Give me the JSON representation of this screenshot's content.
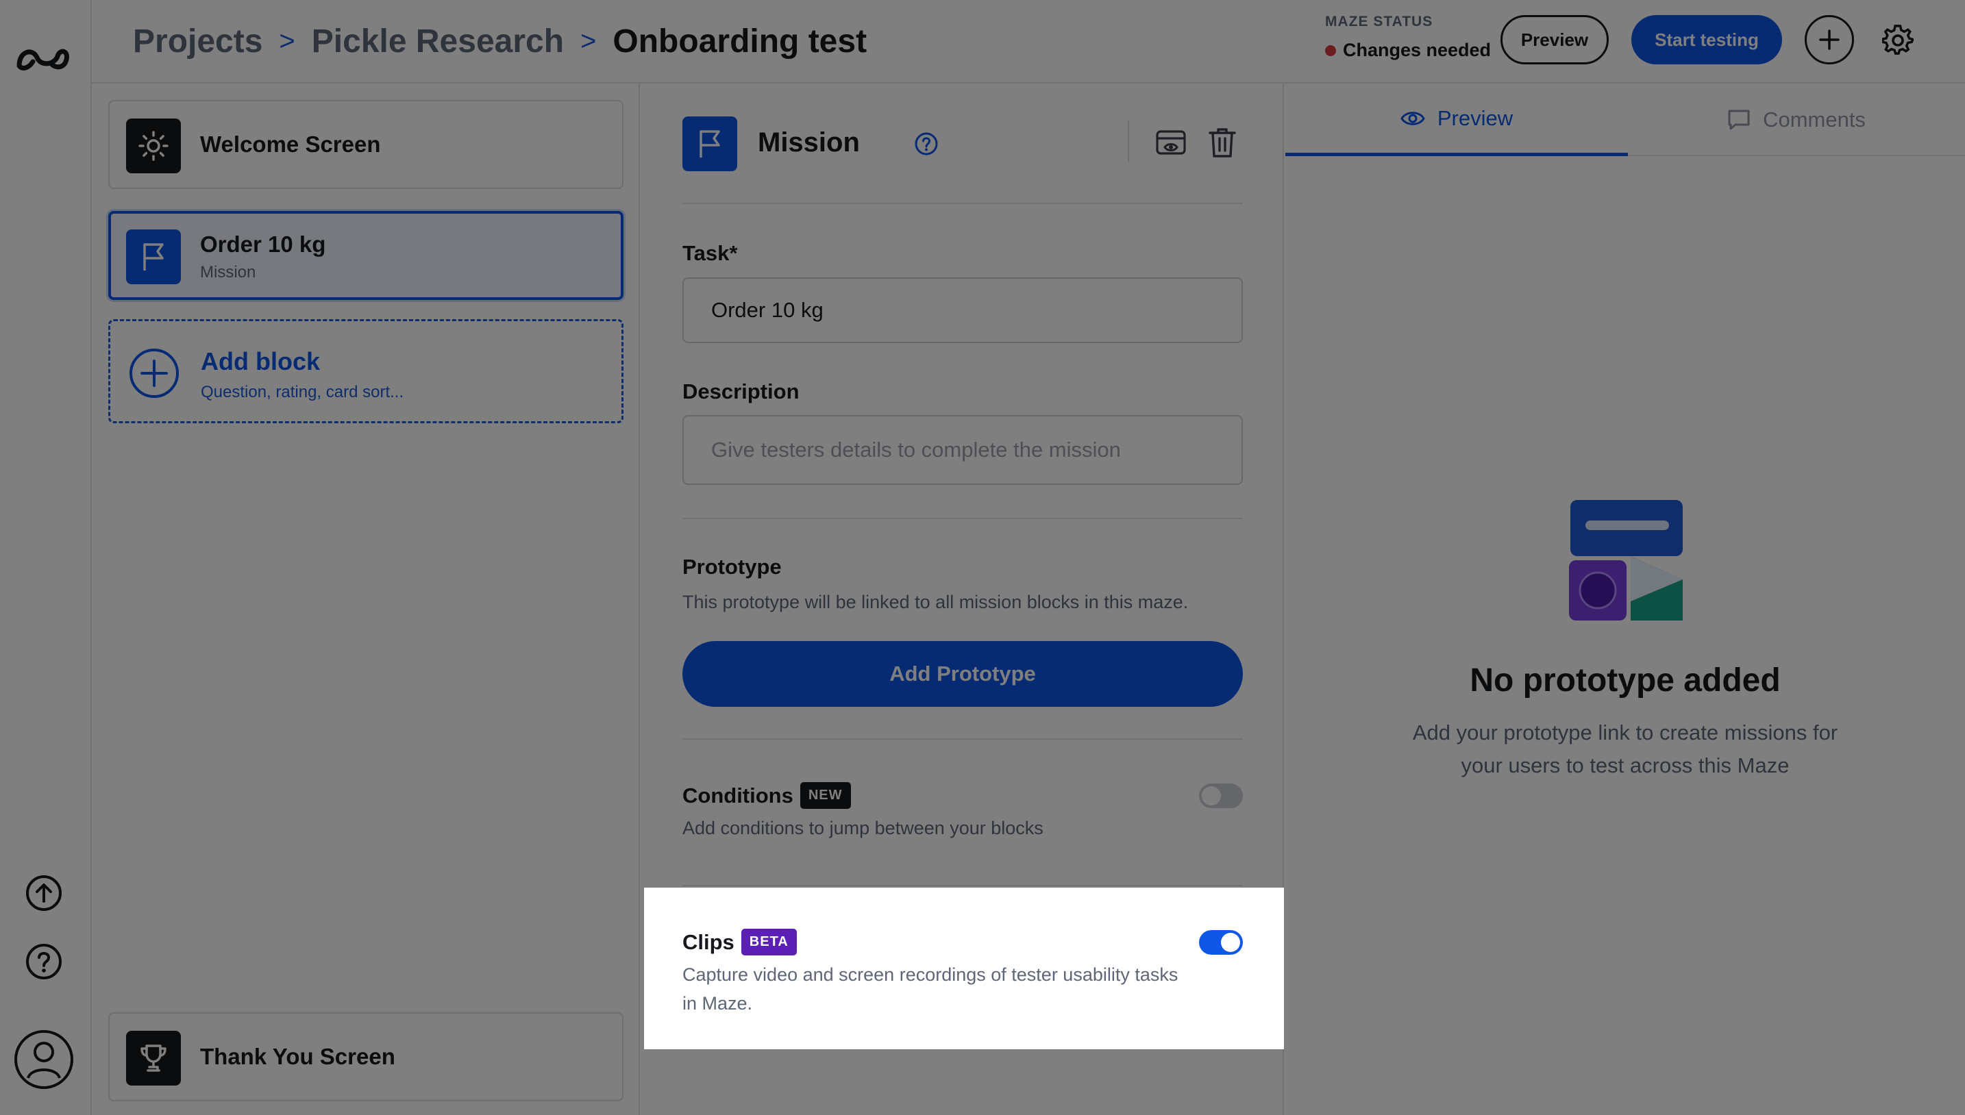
{
  "breadcrumb": {
    "items": [
      "Projects",
      "Pickle Research"
    ],
    "current": "Onboarding test"
  },
  "status": {
    "label": "MAZE STATUS",
    "value": "Changes needed",
    "color": "#d23b3b"
  },
  "header_actions": {
    "preview_label": "Preview",
    "start_label": "Start testing"
  },
  "blocks": {
    "welcome": {
      "title": "Welcome Screen",
      "icon": "sun-icon"
    },
    "mission": {
      "title": "Order 10 kg",
      "subtitle": "Mission",
      "icon": "flag-icon"
    },
    "add": {
      "title": "Add block",
      "subtitle": "Question, rating, card sort...",
      "icon": "plus-circle-icon"
    },
    "thankyou": {
      "title": "Thank You Screen",
      "icon": "trophy-icon"
    }
  },
  "editor": {
    "title": "Mission",
    "task_label": "Task*",
    "task_value": "Order 10 kg",
    "description_label": "Description",
    "description_placeholder": "Give testers details to complete the mission",
    "prototype_label": "Prototype",
    "prototype_sub": "This prototype will be linked to all mission blocks in this maze.",
    "add_prototype_label": "Add Prototype",
    "conditions": {
      "label": "Conditions",
      "tag": "NEW",
      "sub": "Add conditions to jump between your blocks",
      "enabled": false
    },
    "clips": {
      "label": "Clips",
      "tag": "BETA",
      "sub": "Capture video and screen recordings of tester usability tasks in Maze.",
      "enabled": true
    }
  },
  "preview_panel": {
    "tabs": [
      "Preview",
      "Comments"
    ],
    "selected_tab": "Preview",
    "empty_title": "No prototype added",
    "empty_sub": "Add your prototype link to create missions for your users to test across this Maze"
  },
  "colors": {
    "accent": "#0f57e6",
    "beta": "#5b1fb8",
    "overlay": "rgba(0,0,0,0.5)"
  }
}
